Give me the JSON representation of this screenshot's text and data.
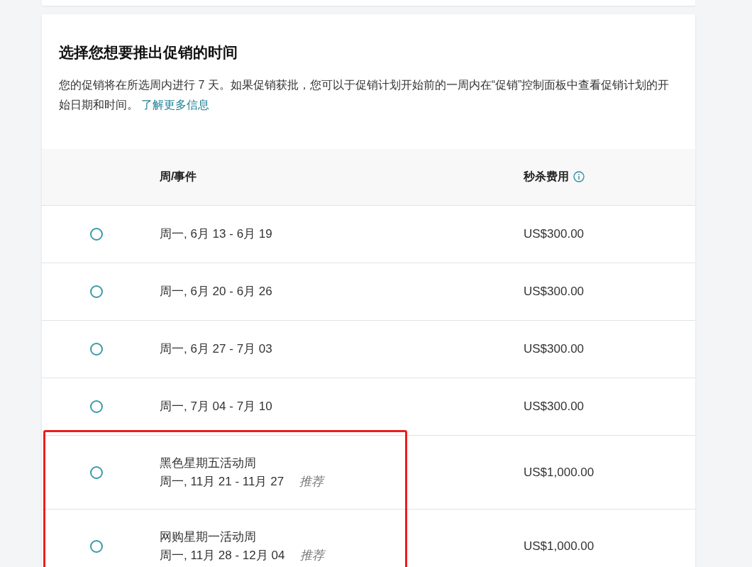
{
  "card": {
    "title": "选择您想要推出促销的时间",
    "description": "您的促销将在所选周内进行 7 天。如果促销获批，您可以于促销计划开始前的一周内在“促销”控制面板中查看促销计划的开始日期和时间。",
    "link": "了解更多信息"
  },
  "table": {
    "columns": [
      {
        "label": "周/事件",
        "info": false
      },
      {
        "label": "秒杀费用",
        "info": true
      }
    ],
    "rows": [
      {
        "selected": false,
        "highlighted": false,
        "week": "周一, 6月 13 - 6月 19",
        "fee": "US$300.00"
      },
      {
        "selected": false,
        "highlighted": false,
        "week": "周一, 6月 20 - 6月 26",
        "fee": "US$300.00"
      },
      {
        "selected": false,
        "highlighted": false,
        "week": "周一, 6月 27 - 7月 03",
        "fee": "US$300.00"
      },
      {
        "selected": false,
        "highlighted": false,
        "week": "周一, 7月 04 - 7月 10",
        "fee": "US$300.00"
      },
      {
        "selected": false,
        "highlighted": true,
        "event": "黑色星期五活动周",
        "week": "周一, 11月 21 - 11月 27",
        "tag": "推荐",
        "fee": "US$1,000.00"
      },
      {
        "selected": false,
        "highlighted": true,
        "event": "网购星期一活动周",
        "week": "周一, 11月 28 - 12月 04",
        "tag": "推荐",
        "fee": "US$1,000.00"
      }
    ]
  }
}
